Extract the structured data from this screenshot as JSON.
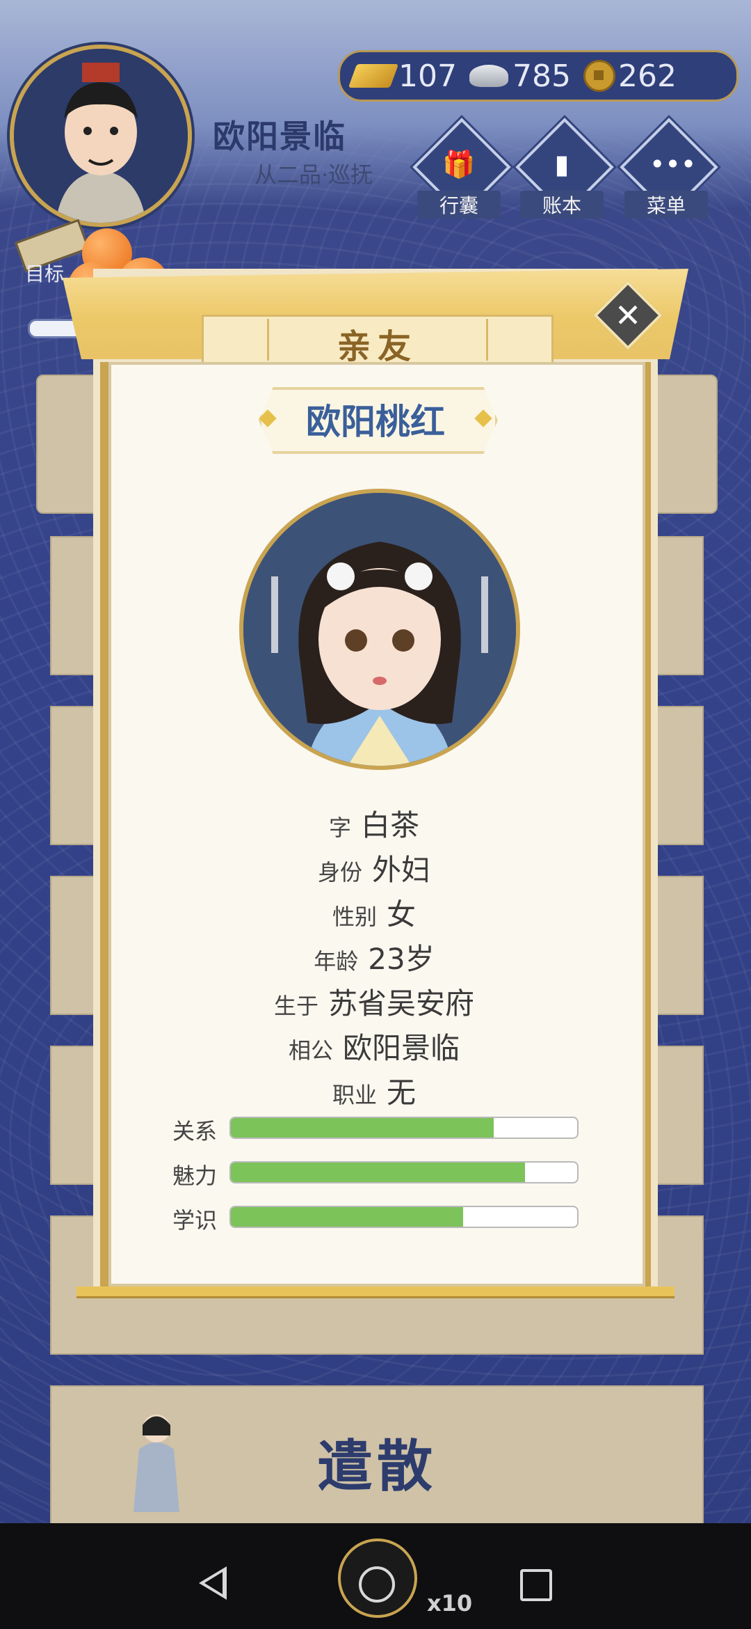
{
  "header": {
    "player_name": "欧阳景临",
    "player_rank": "从二品·巡抚",
    "currency": {
      "gold": "107",
      "silver": "785",
      "coins": "262"
    },
    "menu": [
      {
        "label": "行囊",
        "icon": "bag-icon"
      },
      {
        "label": "账本",
        "icon": "ledger-icon"
      },
      {
        "label": "菜单",
        "icon": "more-icon"
      }
    ],
    "goal_label": "目标"
  },
  "modal": {
    "title": "亲友",
    "character_name": "欧阳桃红",
    "info": [
      {
        "key": "字",
        "value": "白茶"
      },
      {
        "key": "身份",
        "value": "外妇"
      },
      {
        "key": "性别",
        "value": "女"
      },
      {
        "key": "年龄",
        "value": "23岁"
      },
      {
        "key": "生于",
        "value": "苏省吴安府"
      },
      {
        "key": "相公",
        "value": "欧阳景临"
      },
      {
        "key": "职业",
        "value": "无"
      }
    ],
    "stats": [
      {
        "label": "关系",
        "value": 0.76
      },
      {
        "label": "魅力",
        "value": 0.85
      },
      {
        "label": "学识",
        "value": 0.67
      }
    ]
  },
  "background": {
    "disband_label": "遣散"
  },
  "overlay": {
    "share_multiplier": "x10"
  }
}
